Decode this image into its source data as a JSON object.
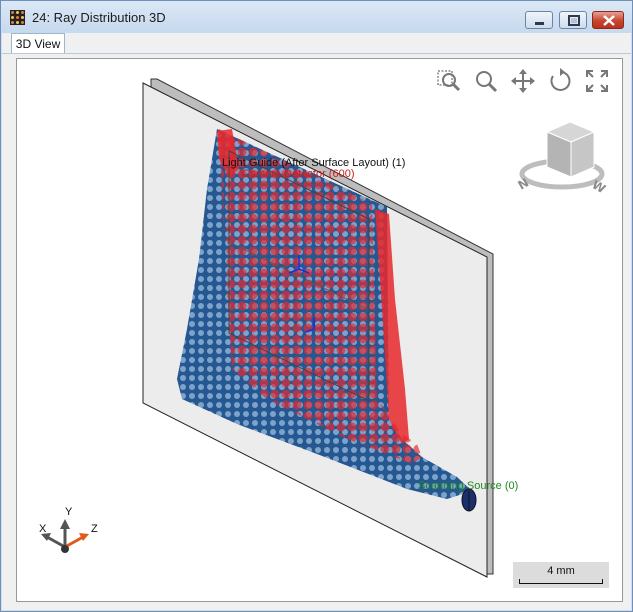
{
  "window": {
    "title": "24: Ray Distribution 3D"
  },
  "tabs": [
    {
      "label": "3D View"
    }
  ],
  "scene": {
    "labels": {
      "light_guide": "Light Guide (After Surface Layout) (1)",
      "camera_detector": "Camera Detector (600)",
      "scanning_source": "Scanning Source (0)"
    },
    "colors": {
      "light_guide": "#111111",
      "camera_detector": "#cc1c1c",
      "scanning_source": "#1e8a1e",
      "ray_blue": "#1b4f8c",
      "ray_red": "#e8282c"
    }
  },
  "axes": {
    "x": "X",
    "y": "Y",
    "z": "Z"
  },
  "scale": {
    "label": "4 mm"
  },
  "toolbar": {
    "icons": [
      "zoom-region-icon",
      "zoom-icon",
      "pan-icon",
      "rotate-icon",
      "fit-view-icon"
    ]
  }
}
